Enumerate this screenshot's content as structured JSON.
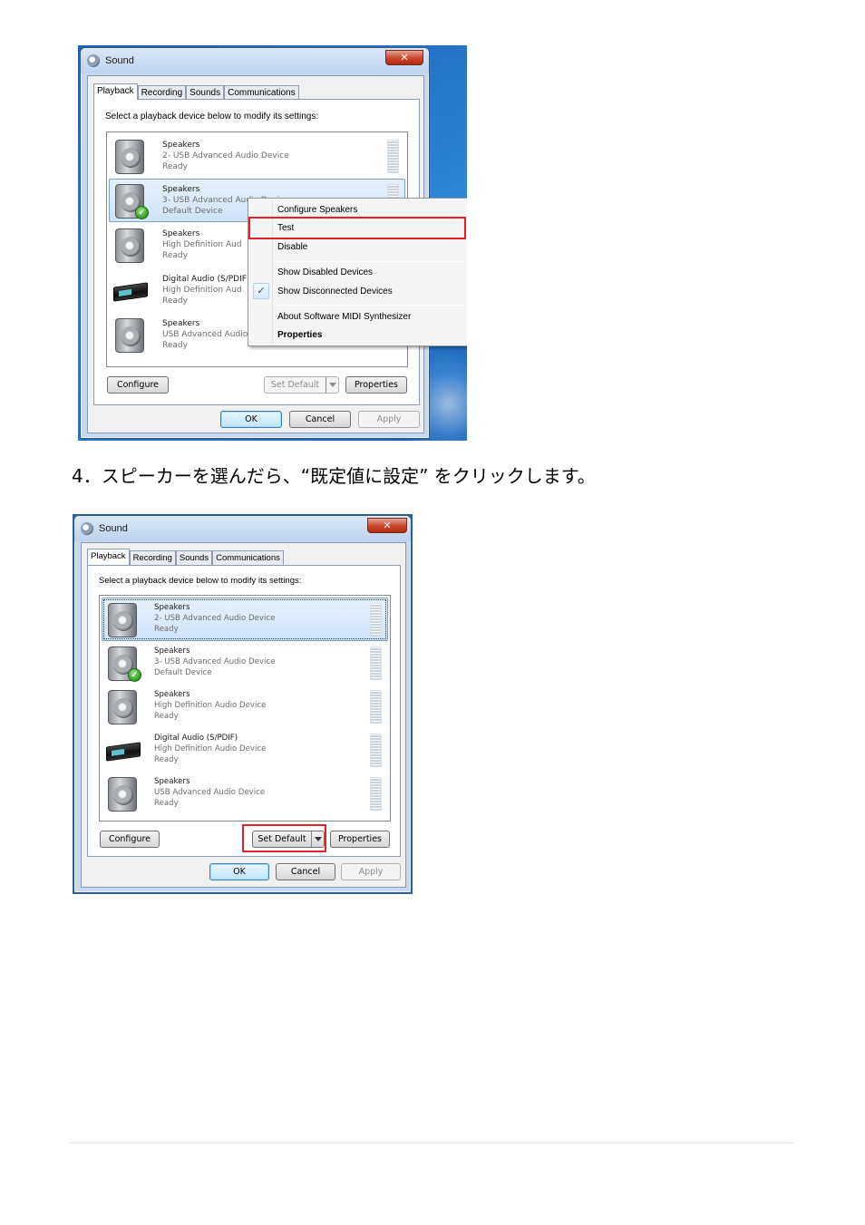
{
  "step_caption": "4．スピーカーを選んだら、“既定値に設定” をクリックします。",
  "colors": {
    "highlight": "#e0222a",
    "selection": "#cfe3f9",
    "desktop": "#2f86d8"
  },
  "screenshot1": {
    "window_title": "Sound",
    "close_label": "✕",
    "tabs": [
      "Playback",
      "Recording",
      "Sounds",
      "Communications"
    ],
    "instruction": "Select a playback device below to modify its settings:",
    "devices": [
      {
        "name": "Speakers",
        "detail": "2- USB Advanced Audio Device",
        "status": "Ready",
        "icon": "speaker-icon"
      },
      {
        "name": "Speakers",
        "detail": "3- USB Advanced Audio Device",
        "status": "Default Device",
        "icon": "speaker-icon",
        "default": true
      },
      {
        "name": "Speakers",
        "detail": "High Definition Aud",
        "status": "Ready",
        "icon": "speaker-icon"
      },
      {
        "name": "Digital Audio (S/PDIF",
        "detail": "High Definition Aud",
        "status": "Ready",
        "icon": "digital-audio-icon"
      },
      {
        "name": "Speakers",
        "detail": "USB Advanced Audio",
        "status": "Ready",
        "icon": "speaker-icon"
      }
    ],
    "context_menu": {
      "items": [
        "Configure Speakers",
        "Test",
        "Disable",
        "Show Disabled Devices",
        "Show Disconnected Devices",
        "About Software MIDI Synthesizer",
        "Properties"
      ],
      "checked_item": "Show Disconnected Devices",
      "check_glyph": "✓",
      "highlighted_item": "Test"
    },
    "buttons": {
      "configure": "Configure",
      "set_default": "Set Default",
      "properties": "Properties",
      "ok": "OK",
      "cancel": "Cancel",
      "apply": "Apply"
    }
  },
  "screenshot2": {
    "window_title": "Sound",
    "close_label": "✕",
    "tabs": [
      "Playback",
      "Recording",
      "Sounds",
      "Communications"
    ],
    "instruction": "Select a playback device below to modify its settings:",
    "devices": [
      {
        "name": "Speakers",
        "detail": "2- USB Advanced Audio Device",
        "status": "Ready",
        "icon": "speaker-icon",
        "selected": true
      },
      {
        "name": "Speakers",
        "detail": "3- USB Advanced Audio Device",
        "status": "Default Device",
        "icon": "speaker-icon",
        "default": true
      },
      {
        "name": "Speakers",
        "detail": "High Definition Audio Device",
        "status": "Ready",
        "icon": "speaker-icon"
      },
      {
        "name": "Digital Audio (S/PDIF)",
        "detail": "High Definition Audio Device",
        "status": "Ready",
        "icon": "digital-audio-icon"
      },
      {
        "name": "Speakers",
        "detail": "USB Advanced Audio Device",
        "status": "Ready",
        "icon": "speaker-icon"
      }
    ],
    "buttons": {
      "configure": "Configure",
      "set_default": "Set Default",
      "properties": "Properties",
      "ok": "OK",
      "cancel": "Cancel",
      "apply": "Apply"
    },
    "highlighted_button": "Set Default"
  }
}
